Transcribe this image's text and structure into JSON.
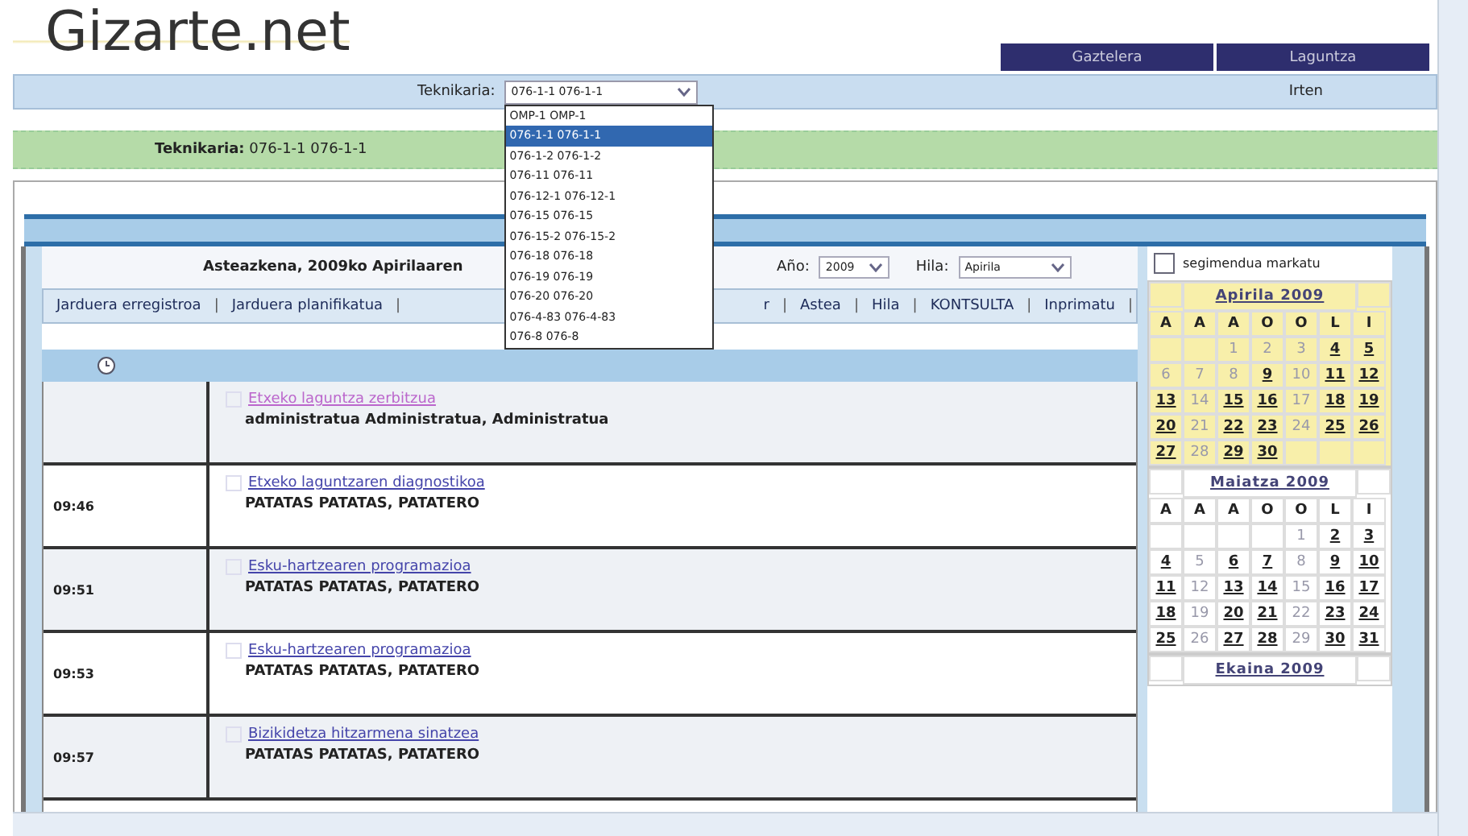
{
  "header": {
    "logo": "Gizarte.net",
    "buttons": [
      "Gaztelera",
      "Laguntza"
    ]
  },
  "topbar": {
    "label": "Teknikaria:",
    "select_value": "076-1-1 076-1-1",
    "exit": "Irten"
  },
  "dropdown": [
    {
      "label": "OMP-1 OMP-1",
      "selected": false
    },
    {
      "label": "076-1-1 076-1-1",
      "selected": true
    },
    {
      "label": "076-1-2 076-1-2",
      "selected": false
    },
    {
      "label": "076-11 076-11",
      "selected": false
    },
    {
      "label": "076-12-1 076-12-1",
      "selected": false
    },
    {
      "label": "076-15 076-15",
      "selected": false
    },
    {
      "label": "076-15-2 076-15-2",
      "selected": false
    },
    {
      "label": "076-18 076-18",
      "selected": false
    },
    {
      "label": "076-19 076-19",
      "selected": false
    },
    {
      "label": "076-20 076-20",
      "selected": false
    },
    {
      "label": "076-4-83 076-4-83",
      "selected": false
    },
    {
      "label": "076-8 076-8",
      "selected": false
    }
  ],
  "technician_bar": {
    "label": "Teknikaria:",
    "value": "076-1-1 076-1-1"
  },
  "day_title": "Asteazkena, 2009ko Apirilaaren",
  "year": {
    "label": "Año:",
    "value": "2009"
  },
  "month": {
    "label": "Hila:",
    "value": "Apirila"
  },
  "nav_left": [
    {
      "kind": "link",
      "text": "Jarduera erregistroa"
    },
    {
      "kind": "separator",
      "text": "|"
    },
    {
      "kind": "link",
      "text": "Jarduera planifikatua"
    },
    {
      "kind": "separator",
      "text": "|"
    }
  ],
  "nav_right": [
    {
      "kind": "link",
      "text": "r"
    },
    {
      "kind": "separator",
      "text": "|"
    },
    {
      "kind": "link",
      "text": "Astea"
    },
    {
      "kind": "separator",
      "text": "|"
    },
    {
      "kind": "link",
      "text": "Hila"
    },
    {
      "kind": "separator",
      "text": "|"
    },
    {
      "kind": "link",
      "text": "KONTSULTA"
    },
    {
      "kind": "separator",
      "text": "|"
    },
    {
      "kind": "link",
      "text": "Inprimatu"
    },
    {
      "kind": "separator",
      "text": "|"
    }
  ],
  "activities": [
    {
      "title": "Etxeko laguntza zerbitzua",
      "person": "administratua Administratua, Administratua",
      "checked": false,
      "visited": true
    },
    {
      "time": "09:46",
      "title": "Etxeko laguntzaren diagnostikoa",
      "person": "PATATAS PATATAS, PATATERO",
      "checked": false,
      "visited": false
    },
    {
      "time": "09:51",
      "title": "Esku-hartzearen programazioa",
      "person": "PATATAS PATATAS, PATATERO",
      "checked": false,
      "visited": false
    },
    {
      "time": "09:53",
      "title": "Esku-hartzearen programazioa",
      "person": "PATATAS PATATAS, PATATERO",
      "checked": false,
      "visited": false
    },
    {
      "time": "09:57",
      "title": "Bizikidetza hitzarmena sinatzea",
      "person": "PATATAS PATATAS, PATATERO",
      "checked": false,
      "visited": false
    }
  ],
  "follow_up": {
    "label": "segimendua markatu",
    "checked": false
  },
  "calendar": {
    "months": [
      {
        "title": "Apirila 2009",
        "current": true,
        "weekdays": [
          "A",
          "A",
          "A",
          "O",
          "O",
          "L",
          "I"
        ],
        "weeks": [
          [
            {
              "day": "1",
              "highlighted": false
            },
            {
              "day": "2",
              "highlighted": false
            },
            {
              "day": "3",
              "highlighted": false
            },
            {
              "day": "4",
              "highlighted": true
            },
            {
              "day": "5",
              "highlighted": true
            }
          ],
          [
            {
              "day": "6",
              "highlighted": false
            },
            {
              "day": "7",
              "highlighted": false
            },
            {
              "day": "8",
              "highlighted": false
            },
            {
              "day": "9",
              "highlighted": true
            },
            {
              "day": "10",
              "highlighted": false
            },
            {
              "day": "11",
              "highlighted": true
            },
            {
              "day": "12",
              "highlighted": true
            }
          ],
          [
            {
              "day": "13",
              "highlighted": true
            },
            {
              "day": "14",
              "highlighted": false
            },
            {
              "day": "15",
              "highlighted": true
            },
            {
              "day": "16",
              "highlighted": true
            },
            {
              "day": "17",
              "highlighted": false
            },
            {
              "day": "18",
              "highlighted": true
            },
            {
              "day": "19",
              "highlighted": true
            }
          ],
          [
            {
              "day": "20",
              "highlighted": true
            },
            {
              "day": "21",
              "highlighted": false
            },
            {
              "day": "22",
              "highlighted": true
            },
            {
              "day": "23",
              "highlighted": true
            },
            {
              "day": "24",
              "highlighted": false
            },
            {
              "day": "25",
              "highlighted": true
            },
            {
              "day": "26",
              "highlighted": true
            }
          ],
          [
            {
              "day": "27",
              "highlighted": true
            },
            {
              "day": "28",
              "highlighted": false
            },
            {
              "day": "29",
              "highlighted": true
            },
            {
              "day": "30",
              "highlighted": true
            }
          ]
        ]
      },
      {
        "title": "Maiatza 2009",
        "current": false,
        "weekdays": [
          "A",
          "A",
          "A",
          "O",
          "O",
          "L",
          "I"
        ],
        "weeks": [
          [
            {
              "day": "1",
              "highlighted": false
            },
            {
              "day": "2",
              "highlighted": true
            },
            {
              "day": "3",
              "highlighted": true
            }
          ],
          [
            {
              "day": "4",
              "highlighted": true
            },
            {
              "day": "5",
              "highlighted": false
            },
            {
              "day": "6",
              "highlighted": true
            },
            {
              "day": "7",
              "highlighted": true
            },
            {
              "day": "8",
              "highlighted": false
            },
            {
              "day": "9",
              "highlighted": true
            },
            {
              "day": "10",
              "highlighted": true
            }
          ],
          [
            {
              "day": "11",
              "highlighted": true
            },
            {
              "day": "12",
              "highlighted": false
            },
            {
              "day": "13",
              "highlighted": true
            },
            {
              "day": "14",
              "highlighted": true
            },
            {
              "day": "15",
              "highlighted": false
            },
            {
              "day": "16",
              "highlighted": true
            },
            {
              "day": "17",
              "highlighted": true
            }
          ],
          [
            {
              "day": "18",
              "highlighted": true
            },
            {
              "day": "19",
              "highlighted": false
            },
            {
              "day": "20",
              "highlighted": true
            },
            {
              "day": "21",
              "highlighted": true
            },
            {
              "day": "22",
              "highlighted": false
            },
            {
              "day": "23",
              "highlighted": true
            },
            {
              "day": "24",
              "highlighted": true
            }
          ],
          [
            {
              "day": "25",
              "highlighted": true
            },
            {
              "day": "26",
              "highlighted": false
            },
            {
              "day": "27",
              "highlighted": true
            },
            {
              "day": "28",
              "highlighted": true
            },
            {
              "day": "29",
              "highlighted": false
            },
            {
              "day": "30",
              "highlighted": true
            },
            {
              "day": "31",
              "highlighted": true
            }
          ]
        ]
      },
      {
        "title": "Ekaina 2009",
        "current": false
      }
    ]
  }
}
